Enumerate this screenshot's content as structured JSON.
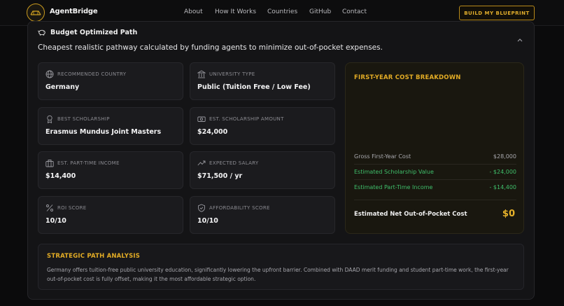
{
  "nav": {
    "brand": "AgentBridge",
    "links": [
      "About",
      "How It Works",
      "Countries",
      "GitHub",
      "Contact"
    ],
    "cta": "BUILD MY BLUEPRINT"
  },
  "path": {
    "title": "Budget Optimized Path",
    "subtitle": "Cheapest realistic pathway calculated by funding agents to minimize out-of-pocket expenses."
  },
  "cards": [
    {
      "label": "RECOMMENDED COUNTRY",
      "value": "Germany",
      "icon": "globe-icon"
    },
    {
      "label": "UNIVERSITY TYPE",
      "value": "Public (Tuition Free / Low Fee)",
      "icon": "university-icon"
    },
    {
      "label": "BEST SCHOLARSHIP",
      "value": "Erasmus Mundus Joint Masters",
      "icon": "award-icon"
    },
    {
      "label": "EST. SCHOLARSHIP AMOUNT",
      "value": "$24,000",
      "icon": "banknote-icon"
    },
    {
      "label": "EST. PART-TIME INCOME",
      "value": "$14,400",
      "icon": "briefcase-icon"
    },
    {
      "label": "EXPECTED SALARY",
      "value": "$71,500 / yr",
      "icon": "trending-up-icon"
    },
    {
      "label": "ROI SCORE",
      "value": "10/10",
      "icon": "percent-icon"
    },
    {
      "label": "AFFORDABILITY SCORE",
      "value": "10/10",
      "icon": "shield-icon"
    }
  ],
  "cost": {
    "title": "FIRST-YEAR COST BREAKDOWN",
    "rows": [
      {
        "label": "Gross First-Year Cost",
        "value": "$28,000"
      },
      {
        "label": "Estimated Scholarship Value",
        "value": "- $24,000"
      },
      {
        "label": "Estimated Part-Time Income",
        "value": "- $14,400"
      }
    ],
    "net_label": "Estimated Net Out-of-Pocket Cost",
    "net_value": "$0"
  },
  "analysis": {
    "title": "STRATEGIC PATH ANALYSIS",
    "body": "Germany offers tuition-free public university education, significantly lowering the upfront barrier. Combined with DAAD merit funding and student part-time work, the first-year out-of-pocket cost is fully offset, making it the most affordable strategic option."
  },
  "colors": {
    "accent": "#e3ac25",
    "positive": "#3fbf6b",
    "background": "#0b0b0c"
  }
}
